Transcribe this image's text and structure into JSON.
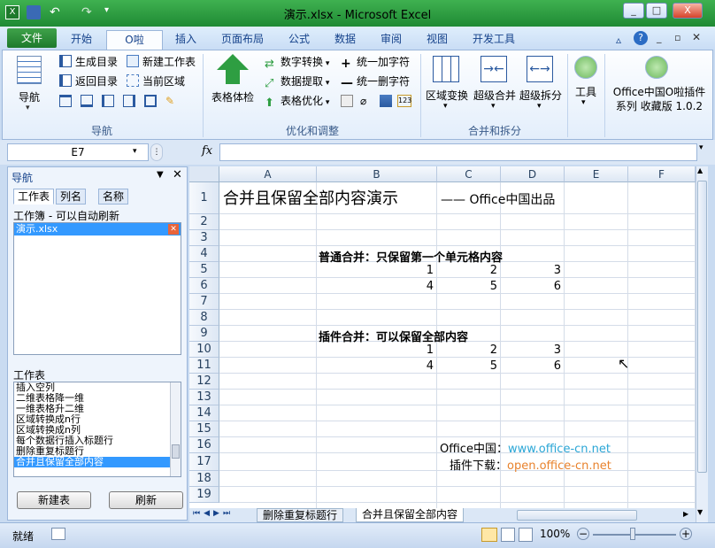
{
  "window": {
    "title": "演示.xlsx - Microsoft Excel",
    "controls": [
      "_",
      "□",
      "X"
    ]
  },
  "ribbon_tabs": [
    "文件",
    "开始",
    "O啦",
    "插入",
    "页面布局",
    "公式",
    "数据",
    "审阅",
    "视图",
    "开发工具"
  ],
  "ribbon": {
    "nav_group": {
      "label": "导航",
      "big_button": "导航",
      "items": [
        "生成目录",
        "新建工作表",
        "返回目录",
        "当前区域"
      ]
    },
    "optimize_group": {
      "label": "优化和调整",
      "big_button": "表格体检",
      "items": [
        "数字转换",
        "统一加字符",
        "数据提取",
        "统一删字符",
        "表格优化"
      ]
    },
    "merge_group": {
      "label": "合并和拆分",
      "buttons": [
        "区域变换",
        "超级合并",
        "超级拆分"
      ]
    },
    "tools_group": {
      "tools": "工具",
      "plugin_line1": "Office中国O啦插件",
      "plugin_line2": "系列 收藏版 1.0.2"
    }
  },
  "formula_bar": {
    "name_box": "E7",
    "fx": "fx",
    "content": ""
  },
  "nav_pane": {
    "title": "导航",
    "tabs": [
      "工作表",
      "列名",
      "名称"
    ],
    "workbook_label": "工作簿 - 可以自动刷新",
    "workbooks": [
      "演示.xlsx"
    ],
    "sheets_label": "工作表",
    "sheets": [
      "插入空列",
      "二维表格降一维",
      "一维表格升二维",
      "区域转换成n行",
      "区域转换成n列",
      "每个数据行插入标题行",
      "删除重复标题行",
      "合并且保留全部内容"
    ],
    "selected_sheet": "合并且保留全部内容",
    "btn_new": "新建表",
    "btn_refresh": "刷新"
  },
  "sheet": {
    "columns": [
      "A",
      "B",
      "C",
      "D",
      "E",
      "F"
    ],
    "rows": [
      "1",
      "2",
      "3",
      "4",
      "5",
      "6",
      "7",
      "8",
      "9",
      "10",
      "11",
      "12",
      "13",
      "14",
      "15",
      "16",
      "17",
      "18",
      "19"
    ],
    "title": "合并且保留全部内容演示",
    "subtitle": "—— Office中国出品",
    "normal_merge": "普通合并：只保留第一个单元格内容",
    "plugin_merge": "插件合并：可以保留全部内容",
    "block1": [
      [
        "1",
        "2",
        "3"
      ],
      [
        "4",
        "5",
        "6"
      ]
    ],
    "block2": [
      [
        "1",
        "2",
        "3"
      ],
      [
        "4",
        "5",
        "6"
      ]
    ],
    "office_label": "Office中国：",
    "office_url": "www.office-cn.net",
    "plugin_label": "插件下载：",
    "plugin_url": "open.office-cn.net"
  },
  "sheet_tabs": [
    "删除重复标题行",
    "合并且保留全部内容"
  ],
  "status": {
    "ready": "就绪",
    "zoom": "100%"
  },
  "colors": {
    "title_green": "#2e9e42",
    "link_blue": "#2aa6d6",
    "link_orange": "#e8822c",
    "selection": "#3399ff"
  }
}
